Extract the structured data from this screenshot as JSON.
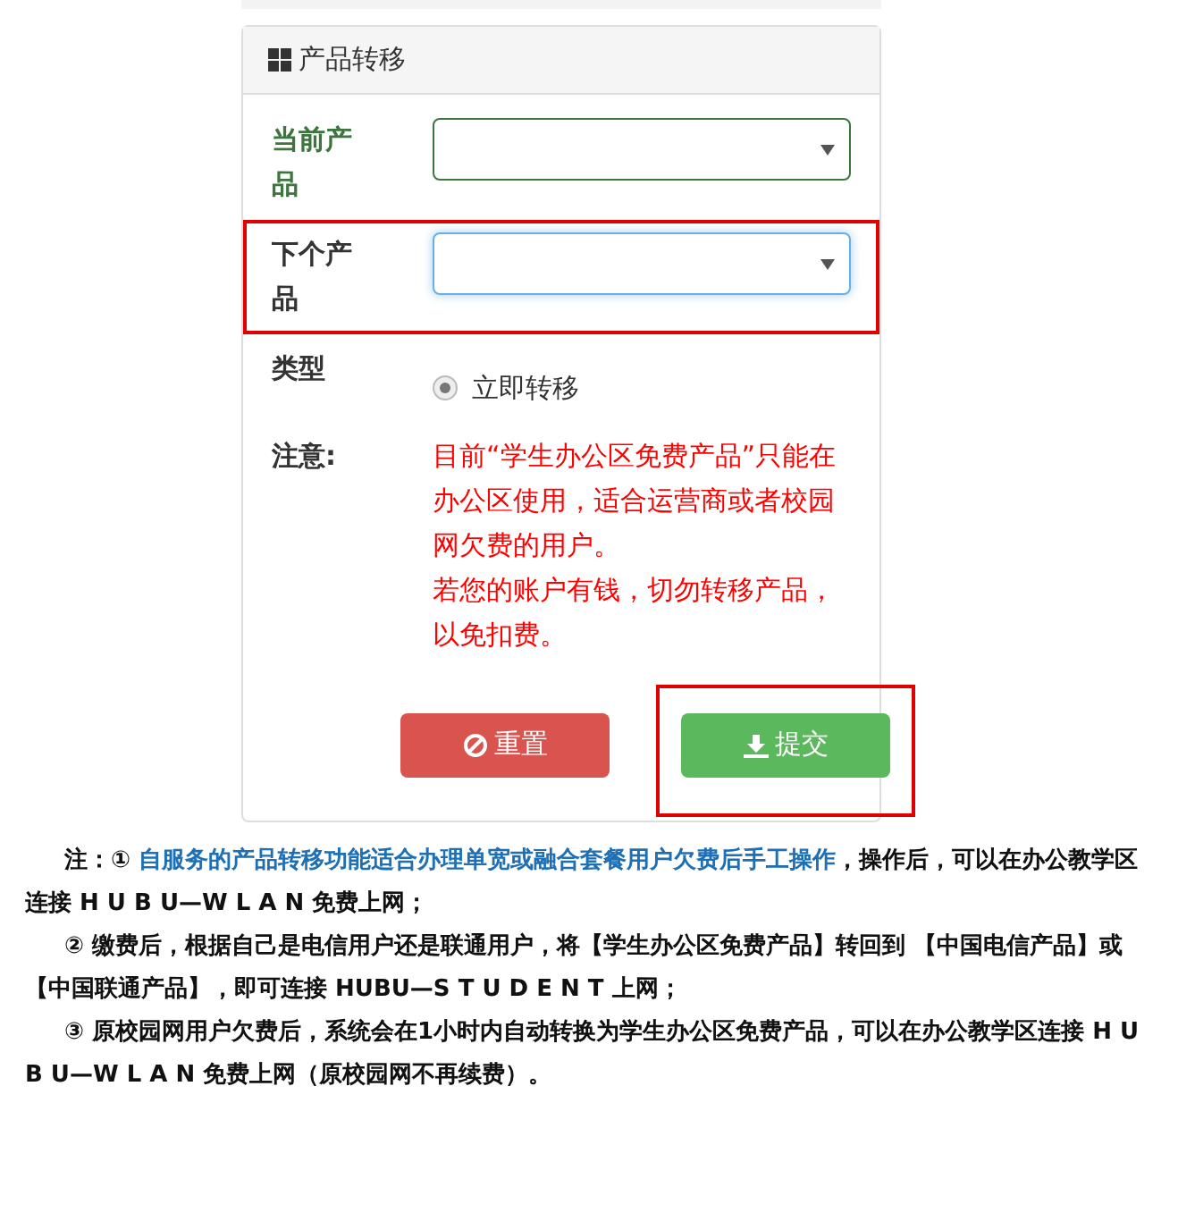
{
  "panel": {
    "title": "产品转移"
  },
  "rows": [
    {
      "kind": "select",
      "label": "当前产品",
      "valid": true,
      "focused": false,
      "highlighted": false
    },
    {
      "kind": "select",
      "label": "下个产品",
      "valid": false,
      "focused": true,
      "highlighted": true
    },
    {
      "kind": "radio",
      "label": "类型",
      "option": "立即转移",
      "checked": true
    },
    {
      "kind": "note",
      "label": "注意:",
      "lines": [
        "目前“学生办公区免费产品”只能在办公区使用，适合运营商或者校园网欠费的用户。",
        "若您的账户有钱，切勿转移产品，以免扣费。"
      ]
    }
  ],
  "buttons": [
    {
      "kind": "reset",
      "label": "重置",
      "highlighted": false
    },
    {
      "kind": "submit",
      "label": "提交",
      "highlighted": true
    }
  ],
  "notes": [
    {
      "lead": "注：① ",
      "highlight": "自服务的产品转移功能适合办理单宽或融合套餐用户欠费后手工操作",
      "rest": "，操作后，可以在办公教学区连接 H U B U—W L A N 免费上网；"
    },
    {
      "lead": "② 缴费后，根据自己是电信用户还是联通用户，将【学生办公区免费产品】转回到 【中国电信产品】或【中国联通产品】，即可连接 HUBU—S T U D E N T 上网；"
    },
    {
      "lead": "③ 原校园网用户欠费后，系统会在1小时内自动转换为学生办公区免费产品，可以在办公教学区连接 H U B U—W L A N 免费上网（原校园网不再续费）。"
    }
  ]
}
